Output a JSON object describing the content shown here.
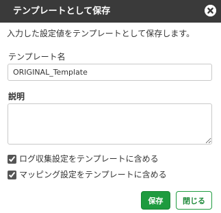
{
  "dialog": {
    "title": "テンプレートとして保存",
    "description": "入力した設定値をテンプレートとして保存します。",
    "name_label": "テンプレート名",
    "name_value": "ORIGINAL_Template",
    "desc_label": "説明",
    "desc_value": "",
    "checkboxes": [
      {
        "label": "ログ収集設定をテンプレートに含める",
        "checked": true
      },
      {
        "label": "マッピング設定をテンプレートに含める",
        "checked": true
      }
    ],
    "save_label": "保存",
    "close_label": "閉じる"
  },
  "colors": {
    "titlebar_bg": "#3a3a3a",
    "save_button": "#1e9b3f",
    "close_button_border": "#1e9b3f"
  },
  "icons": {
    "close": "close-circle-icon"
  }
}
